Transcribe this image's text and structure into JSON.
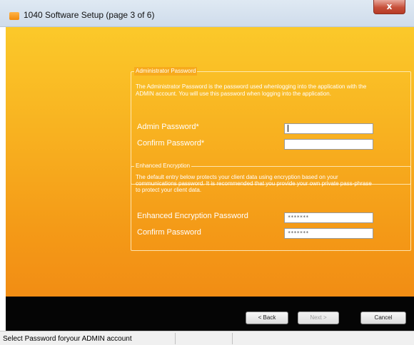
{
  "window": {
    "title": "1040 Software Setup (page 3 of 6)",
    "close_label": "x"
  },
  "admin_group": {
    "title": "Administrator Password",
    "description_line1": "The Administrator Password is the password used whenlogging into the application with the",
    "description_line2": "ADMIN account. You will use this password when logging into the application.",
    "admin_password_label": "Admin Password*",
    "admin_password_value": "",
    "confirm_password_label": "Confirm Password*",
    "confirm_password_value": ""
  },
  "encryption_group": {
    "title": "Enhanced Encryption",
    "description_line1": "The default entry below protects your client data using encryption based on your",
    "description_line2": "communications password. It is recommended that you provide your own private pass-phrase",
    "description_line3": "to protect your client data.",
    "encryption_password_label": "Enhanced Encryption Password",
    "encryption_password_value": "*******",
    "confirm_password_label": "Confirm Password",
    "confirm_password_value": "*******"
  },
  "buttons": {
    "back": "< Back",
    "next": "Next >",
    "cancel": "Cancel"
  },
  "status_bar": {
    "text": "Select Password foryour ADMIN account"
  },
  "colors": {
    "accent": "#f7aa1d",
    "bottom_bar": "#050505"
  }
}
